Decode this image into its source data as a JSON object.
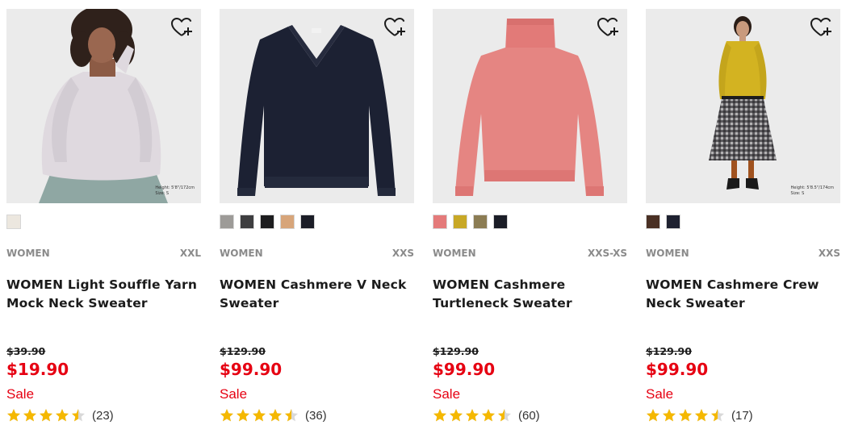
{
  "products": [
    {
      "model_note_height": "Height: 5'8\"/172cm",
      "model_note_size": "Size: S",
      "swatches": [
        "#ece7df"
      ],
      "category": "WOMEN",
      "size_range": "XXL",
      "name": "WOMEN Light Souffle Yarn Mock Neck Sweater",
      "original_price": "$39.90",
      "price": "$19.90",
      "sale_label": "Sale",
      "rating": 4.5,
      "review_count": "(23)"
    },
    {
      "swatches": [
        "#9d9b98",
        "#3e3e40",
        "#1d1d1f",
        "#d7a57a",
        "#1b1d27"
      ],
      "category": "WOMEN",
      "size_range": "XXS",
      "name": "WOMEN Cashmere V Neck Sweater",
      "original_price": "$129.90",
      "price": "$99.90",
      "sale_label": "Sale",
      "rating": 4.5,
      "review_count": "(36)"
    },
    {
      "swatches": [
        "#e47a7a",
        "#c8a826",
        "#8b7c53",
        "#1b1d27"
      ],
      "category": "WOMEN",
      "size_range": "XXS-XS",
      "name": "WOMEN Cashmere Turtleneck Sweater",
      "original_price": "$129.90",
      "price": "$99.90",
      "sale_label": "Sale",
      "rating": 4.5,
      "review_count": "(60)"
    },
    {
      "model_note_height": "Height: 5'8.5\"/174cm",
      "model_note_size": "Size: S",
      "swatches": [
        "#4a3024",
        "#1e2130"
      ],
      "category": "WOMEN",
      "size_range": "XXS",
      "name": "WOMEN Cashmere Crew Neck Sweater",
      "original_price": "$129.90",
      "price": "$99.90",
      "sale_label": "Sale",
      "rating": 4.5,
      "review_count": "(17)"
    }
  ],
  "icons": {
    "wishlist": "heart-plus-icon",
    "star_full": "star-icon",
    "star_half": "half-star-icon"
  },
  "colors": {
    "sale_red": "#e60012",
    "star_gold": "#f5b800",
    "meta_gray": "#8a8a8a"
  }
}
